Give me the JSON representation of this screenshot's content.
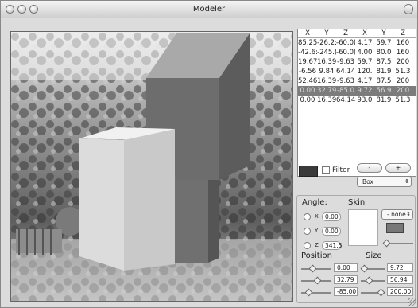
{
  "window": {
    "title": "Modeler"
  },
  "table": {
    "headers": [
      "X",
      "Y",
      "Z",
      "X",
      "Y",
      "Z"
    ],
    "rows": [
      [
        "85.25",
        "-26.2:",
        "-60.0(",
        "4.17",
        "59.7",
        "160"
      ],
      [
        "-42.6:",
        "-245.(",
        "-60.0(",
        "4.00",
        "80.0",
        "160"
      ],
      [
        "19.67",
        "16.39",
        "-9.63",
        "59.7",
        "87.5",
        "200"
      ],
      [
        "-6.56",
        "9.84",
        "64.14",
        "120.",
        "81.9",
        "51.3"
      ],
      [
        "52.46",
        "16.39",
        "-9.63",
        "4.17",
        "87.5",
        "200"
      ],
      [
        "0.00",
        "32.79",
        "-85.0",
        "9.72",
        "56.9",
        "200"
      ],
      [
        "0.00",
        "16.39",
        "64.14",
        "93.0",
        "81.9",
        "51.3"
      ]
    ],
    "selected_row": 5
  },
  "color_swatch": {
    "color": "#3a3a3a"
  },
  "filter": {
    "label": "Filter",
    "checked": false
  },
  "buttons": {
    "minus": "-",
    "plus": "+"
  },
  "shape_select": {
    "value": "Box"
  },
  "angle": {
    "label": "Angle:",
    "x_label": "X",
    "y_label": "Y",
    "z_label": "Z",
    "x": "0.00",
    "y": "0.00",
    "z": "341.5"
  },
  "skin": {
    "label": "Skin",
    "select_value": "- none -",
    "color": "#777777"
  },
  "position": {
    "label": "Position",
    "x": "0.00",
    "y": "32.79",
    "z": "-85.00",
    "fractions": [
      0.35,
      0.55,
      0.2
    ]
  },
  "size": {
    "label": "Size",
    "x": "9.72",
    "y": "56.94",
    "z": "200.00",
    "fractions": [
      0.05,
      0.3,
      0.95
    ]
  }
}
